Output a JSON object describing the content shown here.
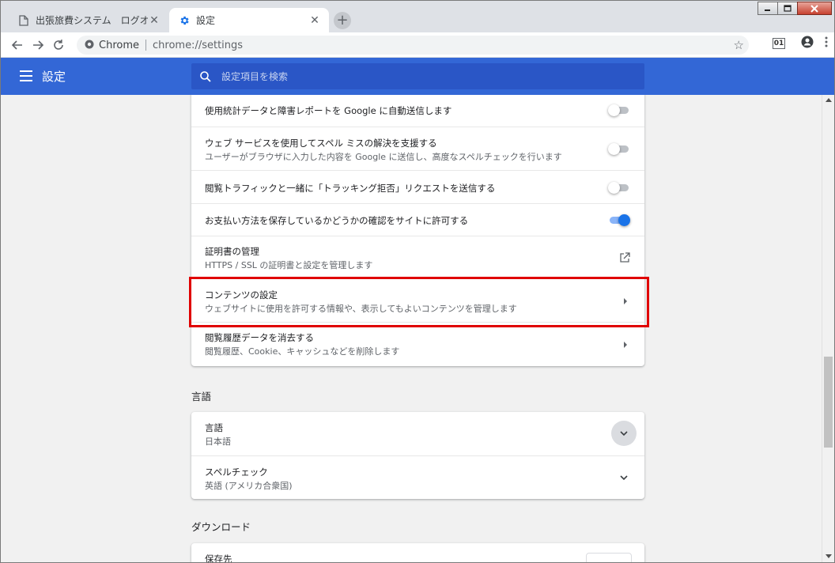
{
  "window": {
    "controls": {
      "minimize": "0",
      "maximize": "1",
      "close": "r"
    }
  },
  "tabs": [
    {
      "title": "出張旅費システム　ログオン",
      "icon": "page-icon",
      "active": false
    },
    {
      "title": "設定",
      "icon": "gear-icon",
      "active": true
    }
  ],
  "toolbar": {
    "site_label": "Chrome",
    "url": "chrome://settings",
    "extension_label": "01"
  },
  "header": {
    "title": "設定",
    "search_placeholder": "設定項目を検索"
  },
  "privacy_rows": [
    {
      "primary": "使用統計データと障害レポートを Google に自動送信します",
      "secondary": "",
      "control": "toggle",
      "on": false
    },
    {
      "primary": "ウェブ サービスを使用してスペル ミスの解決を支援する",
      "secondary": "ユーザーがブラウザに入力した内容を Google に送信し、高度なスペルチェックを行います",
      "control": "toggle",
      "on": false
    },
    {
      "primary": "閲覧トラフィックと一緒に「トラッキング拒否」リクエストを送信する",
      "secondary": "",
      "control": "toggle",
      "on": false
    },
    {
      "primary": "お支払い方法を保存しているかどうかの確認をサイトに許可する",
      "secondary": "",
      "control": "toggle",
      "on": true
    },
    {
      "primary": "証明書の管理",
      "secondary": "HTTPS / SSL の証明書と設定を管理します",
      "control": "external-link"
    },
    {
      "primary": "コンテンツの設定",
      "secondary": "ウェブサイトに使用を許可する情報や、表示してもよいコンテンツを管理します",
      "control": "chevron-right"
    },
    {
      "primary": "閲覧履歴データを消去する",
      "secondary": "閲覧履歴、Cookie、キャッシュなどを削除します",
      "control": "chevron-right"
    }
  ],
  "language_section": {
    "title": "言語",
    "rows": [
      {
        "primary": "言語",
        "secondary": "日本語"
      },
      {
        "primary": "スペルチェック",
        "secondary": "英語 (アメリカ合衆国)"
      }
    ]
  },
  "download_section": {
    "title": "ダウンロード",
    "rows": [
      {
        "primary": "保存先"
      }
    ]
  },
  "colors": {
    "header_blue": "#3367d6",
    "search_blue": "#2a56c6",
    "toggle_on": "#1a73e8",
    "highlight_red": "#e00000"
  }
}
